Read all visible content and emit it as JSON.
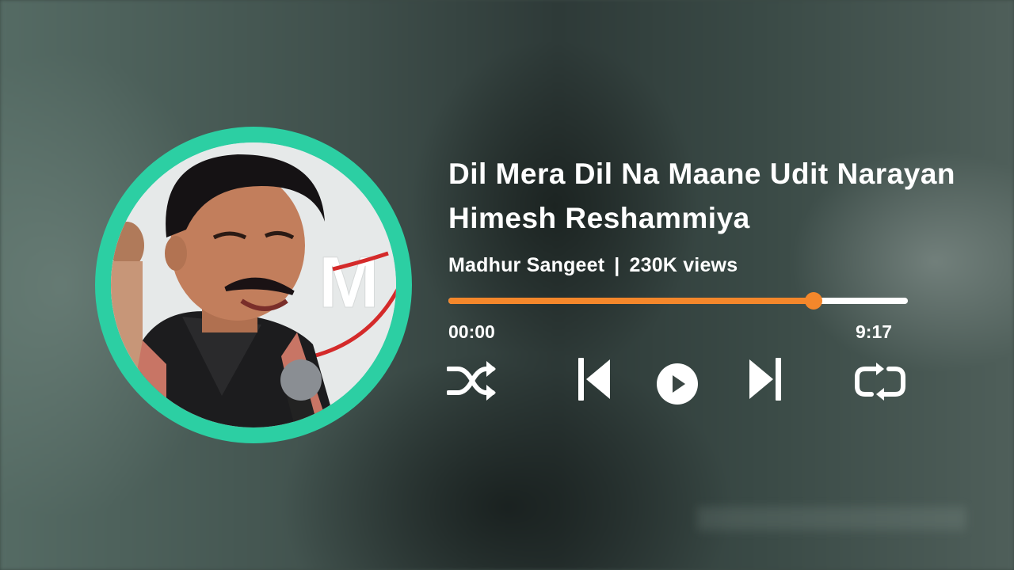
{
  "song": {
    "title": "Dil Mera Dil Na Maane Udit Narayan Himesh Reshammiya",
    "channel": "Madhur Sangeet",
    "separator": "|",
    "views": "230K views"
  },
  "player": {
    "current_time": "00:00",
    "duration": "9:17",
    "progress_fraction": 0.795,
    "controls": [
      "shuffle-icon",
      "previous-icon",
      "play-icon",
      "next-icon",
      "repeat-icon"
    ]
  },
  "artwork": {
    "logo_text": "M"
  },
  "colors": {
    "ring": "#2ccfa3",
    "progress_fill": "#f4872b",
    "progress_track": "#ffffff",
    "text": "#ffffff"
  }
}
